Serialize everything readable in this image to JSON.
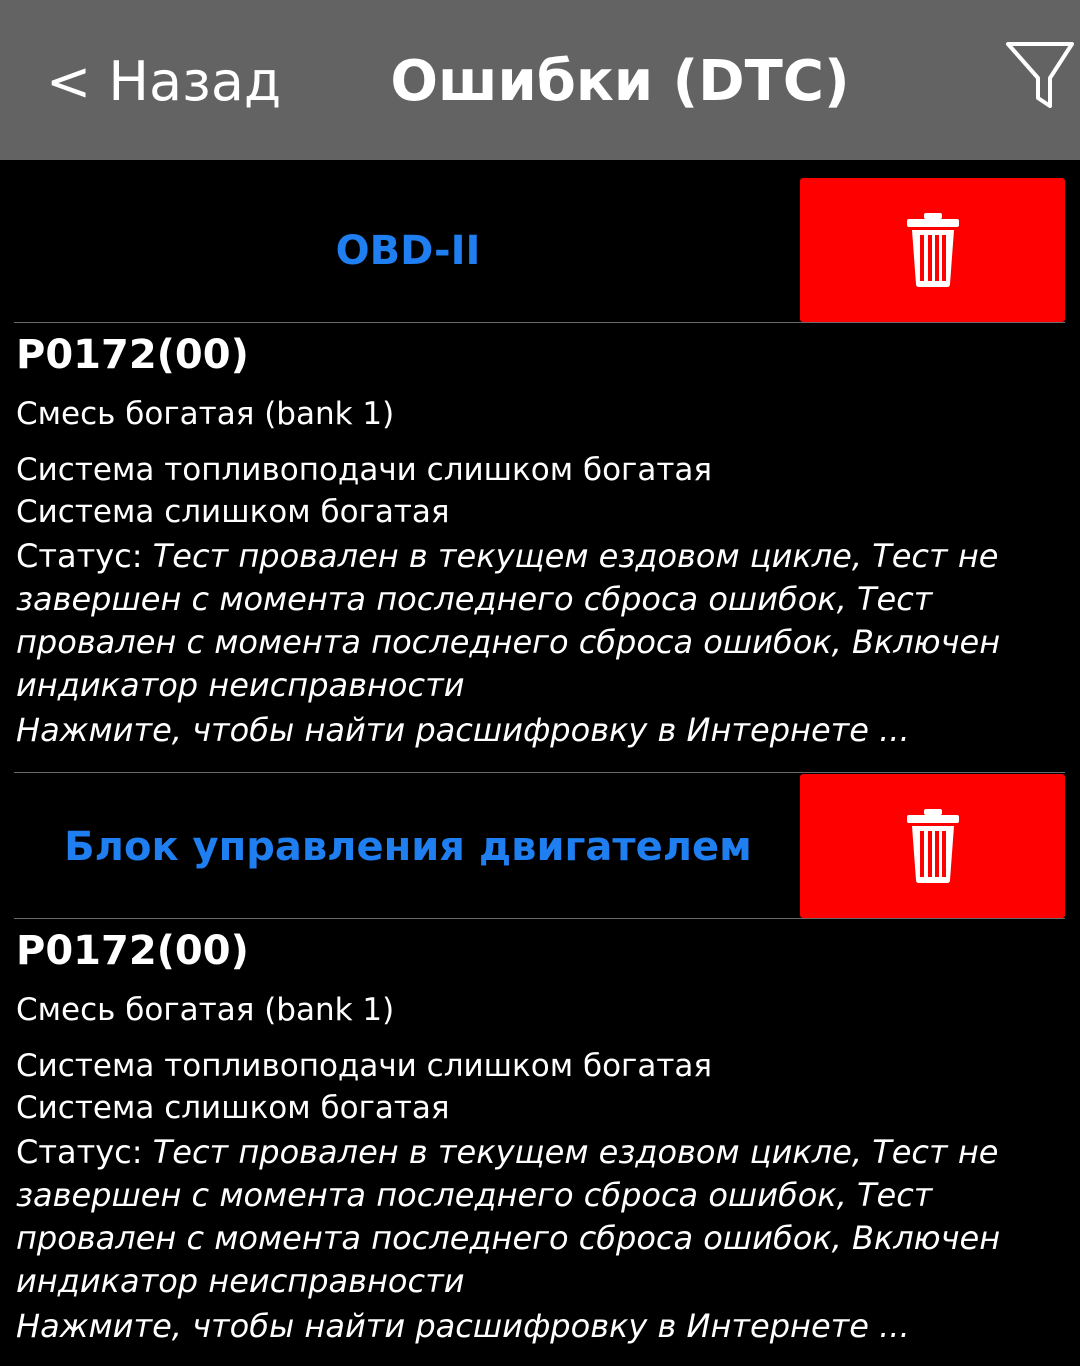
{
  "header": {
    "back_label": "< Назад",
    "title": "Ошибки (DTC)"
  },
  "colors": {
    "header_bg": "#636363",
    "module_title": "#1f7ef0",
    "delete_bg": "#ff0000",
    "background": "#000000"
  },
  "icons": {
    "filter": "funnel-filter-icon",
    "delete": "trash-icon"
  },
  "sections": [
    {
      "module": "OBD-II",
      "dtc": {
        "code": "P0172(00)",
        "description": "Смесь богатая (bank 1)",
        "detail_line1": "Система топливоподачи слишком богатая",
        "detail_line2": "Система слишком богатая",
        "status_label": "Статус:",
        "status_line1": "Тест провален в текущем ездовом цикле, Тест не",
        "status_line2": "завершен с момента последнего сброса ошибок, Тест",
        "status_line3": "провален с момента последнего сброса ошибок, Включен",
        "status_line4": "индикатор неисправности",
        "link": "Нажмите, чтобы найти расшифровку в Интернете ..."
      }
    },
    {
      "module": "Блок управления двигателем",
      "dtc": {
        "code": "P0172(00)",
        "description": "Смесь богатая (bank 1)",
        "detail_line1": "Система топливоподачи слишком богатая",
        "detail_line2": "Система слишком богатая",
        "status_label": "Статус:",
        "status_line1": "Тест провален в текущем ездовом цикле, Тест не",
        "status_line2": "завершен с момента последнего сброса ошибок, Тест",
        "status_line3": "провален с момента последнего сброса ошибок, Включен",
        "status_line4": "индикатор неисправности",
        "link": "Нажмите, чтобы найти расшифровку в Интернете ..."
      }
    }
  ]
}
